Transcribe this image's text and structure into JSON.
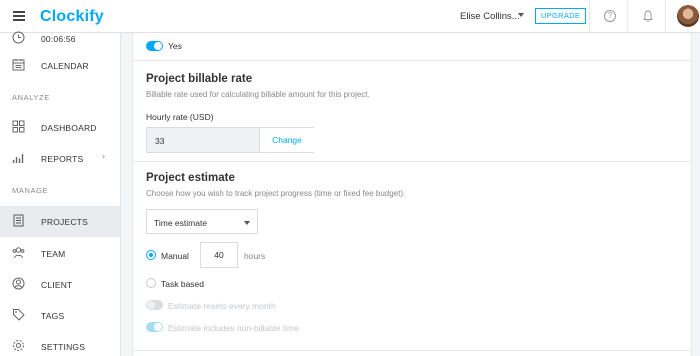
{
  "app": {
    "logo": "Clockify",
    "user_name": "Elise Collins...",
    "upgrade_label": "UPGRADE"
  },
  "sidebar": {
    "time_fragment": "00:06:56",
    "sections": {
      "analyze": "ANALYZE",
      "manage": "MANAGE"
    },
    "items": {
      "calendar": "CALENDAR",
      "dashboard": "DASHBOARD",
      "reports": "REPORTS",
      "projects": "PROJECTS",
      "team": "TEAM",
      "client": "CLIENT",
      "tags": "TAGS",
      "settings": "SETTINGS"
    },
    "active": "projects"
  },
  "main": {
    "billable_toggle_label": "Yes",
    "billable_toggle_on": true,
    "rate": {
      "title": "Project billable rate",
      "description": "Billable rate used for calculating billable amount for this project.",
      "field_label": "Hourly rate (USD)",
      "value": "33",
      "change_label": "Change"
    },
    "estimate": {
      "title": "Project estimate",
      "description": "Choose how you wish to track project progress (time or fixed fee budget).",
      "select_value": "Time estimate",
      "manual_label": "Manual",
      "manual_checked": true,
      "hours_value": "40",
      "hours_unit": "hours",
      "task_based_label": "Task based",
      "resets_label": "Estimate resets every month",
      "includes_label": "Estimate includes non-billable time"
    }
  },
  "colors": {
    "accent": "#03a9f4",
    "sidebar_active": "#e9ecee",
    "background": "#f2f6f8"
  }
}
